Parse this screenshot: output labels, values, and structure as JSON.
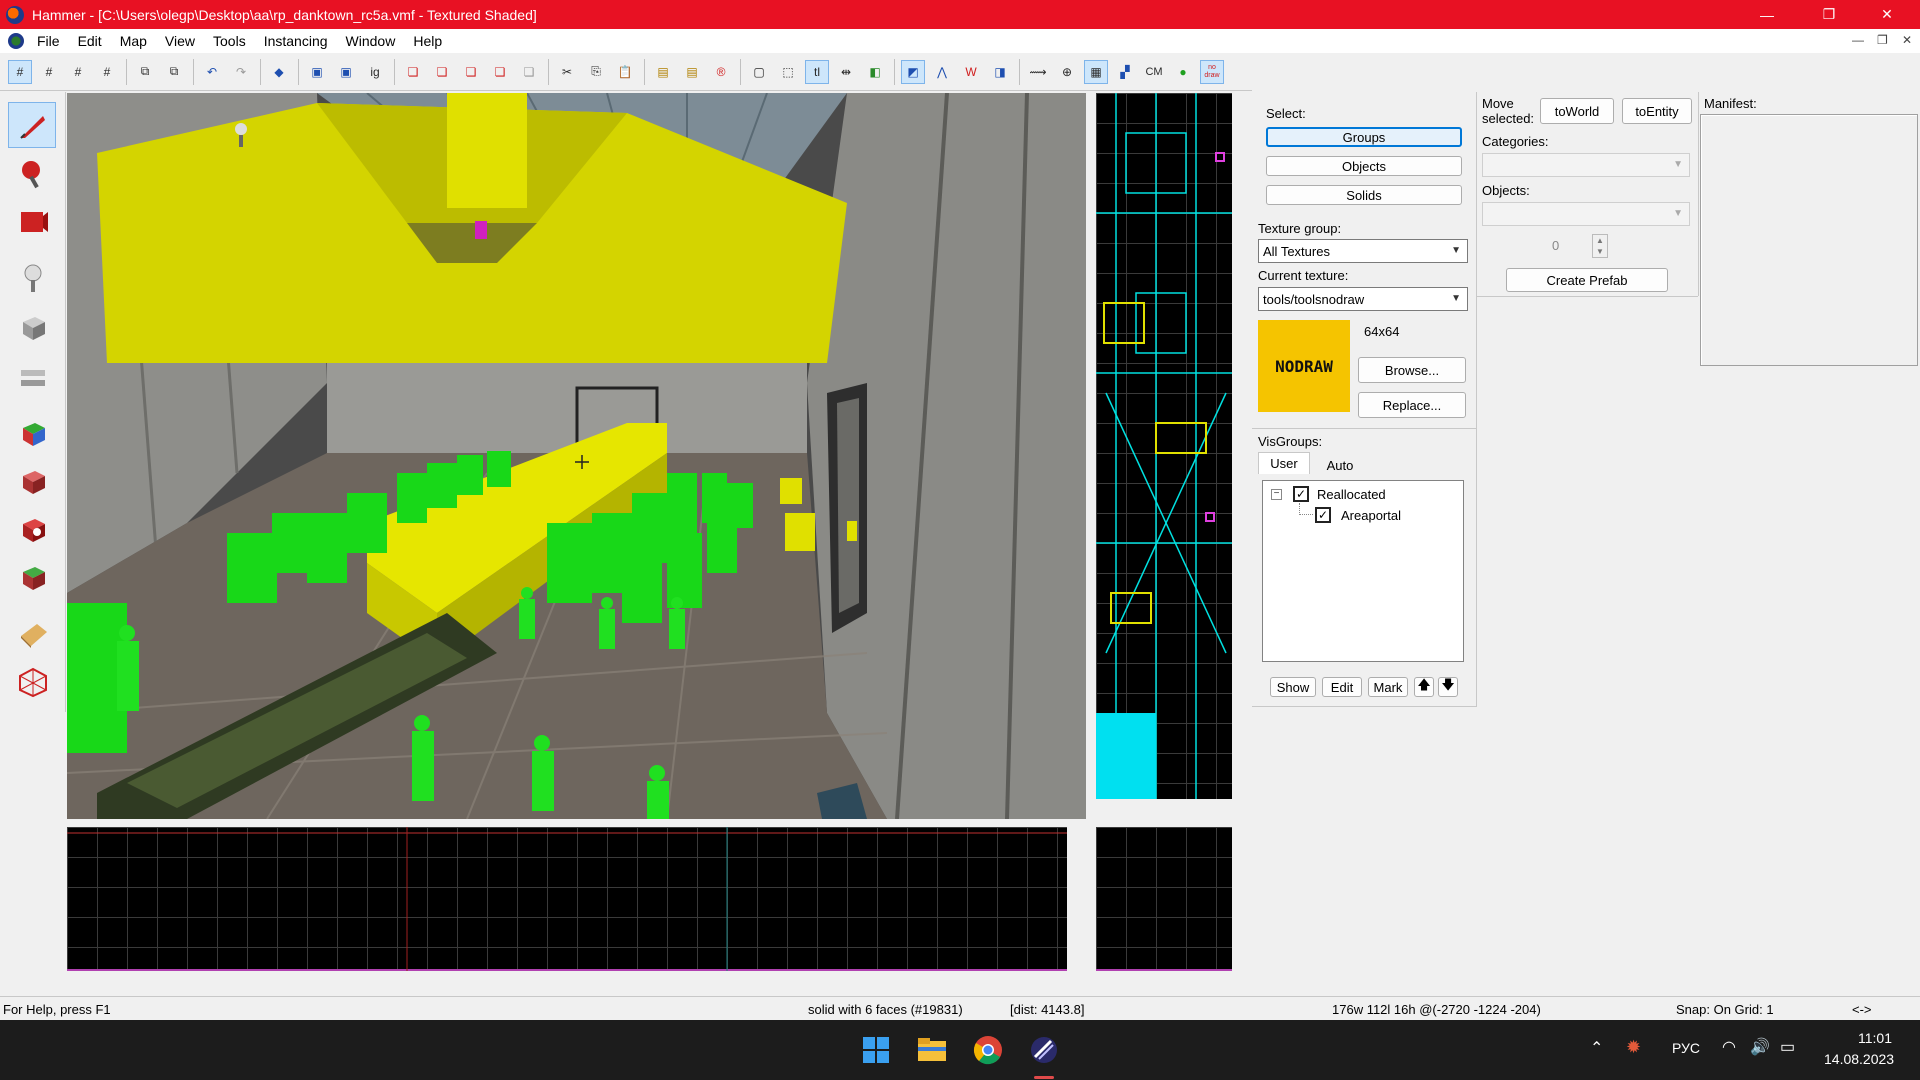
{
  "window": {
    "title": "Hammer - [C:\\Users\\olegp\\Desktop\\aa\\rp_danktown_rc5a.vmf - Textured Shaded]",
    "controls": {
      "minimize": "—",
      "restore": "❐",
      "close": "✕"
    }
  },
  "menu": [
    "File",
    "Edit",
    "Map",
    "View",
    "Tools",
    "Instancing",
    "Window",
    "Help"
  ],
  "toolbar": {
    "cm_label": "CM",
    "nodraw_label": "no draw"
  },
  "select_panel": {
    "label": "Select:",
    "buttons": [
      "Groups",
      "Objects",
      "Solids"
    ],
    "selected": "Groups"
  },
  "texture_panel": {
    "group_label": "Texture group:",
    "group_value": "All Textures",
    "current_label": "Current texture:",
    "current_value": "tools/toolsnodraw",
    "size": "64x64",
    "preview_text": "NODRAW",
    "browse": "Browse...",
    "replace": "Replace..."
  },
  "visgroups": {
    "label": "VisGroups:",
    "tabs": [
      "User",
      "Auto"
    ],
    "tree": [
      {
        "name": "Reallocated",
        "checked": true
      },
      {
        "name": "Areaportal",
        "checked": true
      }
    ],
    "buttons": {
      "show": "Show",
      "edit": "Edit",
      "mark": "Mark",
      "up": "🡅",
      "down": "🡇"
    }
  },
  "move_panel": {
    "label": "Move selected:",
    "to_world": "toWorld",
    "to_entity": "toEntity",
    "categories_label": "Categories:",
    "objects_label": "Objects:",
    "spinner_value": "0",
    "create_prefab": "Create Prefab"
  },
  "manifest": {
    "label": "Manifest:"
  },
  "statusbar": {
    "help": "For Help, press F1",
    "selection": "solid with 6 faces (#19831)",
    "dist": "[dist: 4143.8]",
    "dims": "176w 112l 16h @(-2720 -1224 -204)",
    "snap": "Snap: On Grid: 1",
    "arrows": "<->"
  },
  "taskbar": {
    "lang": "РУС",
    "time": "11:01",
    "date": "14.08.2023"
  },
  "colors": {
    "title_bar": "#e81123",
    "nodraw_yellow": "#f5c400",
    "accent": "#0078d7"
  }
}
